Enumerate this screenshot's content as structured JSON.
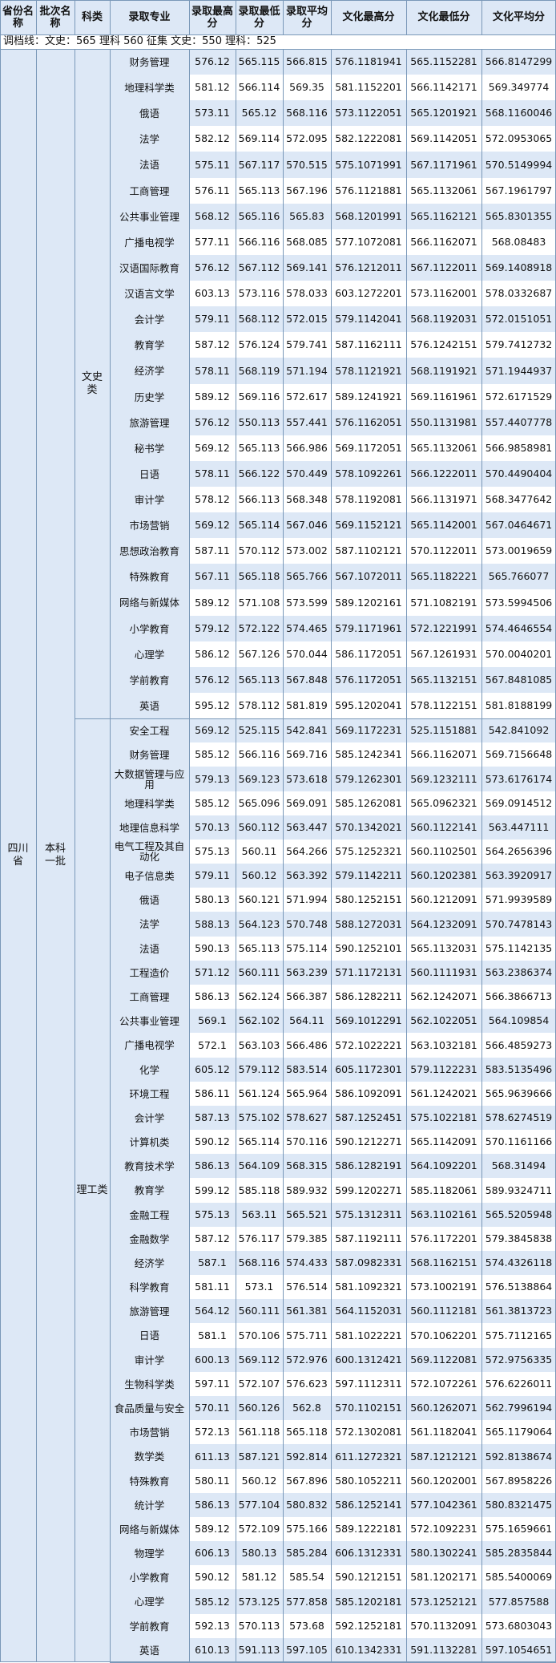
{
  "headers": [
    "省份名称",
    "批次名称",
    "科类",
    "录取专业",
    "录取最高分",
    "录取最低分",
    "录取平均分",
    "文化最高分",
    "文化最低分",
    "文化平均分"
  ],
  "note": "调档线：文史：565  理科 560 征集 文史：550 理科：525",
  "province": "四川省",
  "batch": "本科一批",
  "groups": [
    {
      "name": "文史类",
      "rows": [
        [
          "财务管理",
          "576.12",
          "565.115",
          "566.815",
          "576.1181941",
          "565.1152281",
          "566.8147299"
        ],
        [
          "地理科学类",
          "581.12",
          "566.114",
          "569.35",
          "581.1152201",
          "566.1142171",
          "569.349774"
        ],
        [
          "俄语",
          "573.11",
          "565.12",
          "568.116",
          "573.1122051",
          "565.1201921",
          "568.1160046"
        ],
        [
          "法学",
          "582.12",
          "569.114",
          "572.095",
          "582.1222081",
          "569.1142051",
          "572.0953065"
        ],
        [
          "法语",
          "575.11",
          "567.117",
          "570.515",
          "575.1071991",
          "567.1171961",
          "570.5149994"
        ],
        [
          "工商管理",
          "576.11",
          "565.113",
          "567.196",
          "576.1121881",
          "565.1132061",
          "567.1961797"
        ],
        [
          "公共事业管理",
          "568.12",
          "565.116",
          "565.83",
          "568.1201991",
          "565.1162121",
          "565.8301355"
        ],
        [
          "广播电视学",
          "577.11",
          "566.116",
          "568.085",
          "577.1072081",
          "566.1162071",
          "568.08483"
        ],
        [
          "汉语国际教育",
          "576.12",
          "567.112",
          "569.141",
          "576.1212011",
          "567.1122011",
          "569.1408918"
        ],
        [
          "汉语言文学",
          "603.13",
          "573.116",
          "578.033",
          "603.1272201",
          "573.1162001",
          "578.0332687"
        ],
        [
          "会计学",
          "579.11",
          "568.112",
          "572.015",
          "579.1142041",
          "568.1192031",
          "572.0151051"
        ],
        [
          "教育学",
          "587.12",
          "576.124",
          "579.741",
          "587.1162111",
          "576.1242151",
          "579.7412732"
        ],
        [
          "经济学",
          "578.11",
          "568.119",
          "571.194",
          "578.1121921",
          "568.1191921",
          "571.1944937"
        ],
        [
          "历史学",
          "589.12",
          "569.116",
          "572.617",
          "589.1241921",
          "569.1161961",
          "572.6171529"
        ],
        [
          "旅游管理",
          "576.12",
          "550.113",
          "557.441",
          "576.1162051",
          "550.1131981",
          "557.4407778"
        ],
        [
          "秘书学",
          "569.12",
          "565.113",
          "566.986",
          "569.1172051",
          "565.1132061",
          "566.9858981"
        ],
        [
          "日语",
          "578.11",
          "566.122",
          "570.449",
          "578.1092261",
          "566.1222011",
          "570.4490404"
        ],
        [
          "审计学",
          "578.12",
          "566.113",
          "568.348",
          "578.1192081",
          "566.1131971",
          "568.3477642"
        ],
        [
          "市场营销",
          "569.12",
          "565.114",
          "567.046",
          "569.1152121",
          "565.1142001",
          "567.0464671"
        ],
        [
          "思想政治教育",
          "587.11",
          "570.112",
          "573.002",
          "587.1102121",
          "570.1122011",
          "573.0019659"
        ],
        [
          "特殊教育",
          "567.11",
          "565.118",
          "565.766",
          "567.1072011",
          "565.1182221",
          "565.766077"
        ],
        [
          "网络与新媒体",
          "589.12",
          "571.108",
          "573.599",
          "589.1202161",
          "571.1082191",
          "573.5994506"
        ],
        [
          "小学教育",
          "579.12",
          "572.122",
          "574.465",
          "579.1171961",
          "572.1221991",
          "574.4646554"
        ],
        [
          "心理学",
          "586.12",
          "567.126",
          "570.044",
          "586.1172051",
          "567.1261931",
          "570.0040201"
        ],
        [
          "学前教育",
          "576.12",
          "565.113",
          "567.848",
          "576.1172051",
          "565.1132151",
          "567.8481085"
        ],
        [
          "英语",
          "595.12",
          "578.112",
          "581.819",
          "595.1202041",
          "578.1122151",
          "581.8188199"
        ]
      ]
    },
    {
      "name": "理工类",
      "rows": [
        [
          "安全工程",
          "569.12",
          "525.115",
          "542.841",
          "569.1172231",
          "525.1151881",
          "542.841092"
        ],
        [
          "财务管理",
          "585.12",
          "566.116",
          "569.716",
          "585.1242341",
          "566.1162071",
          "569.7156648"
        ],
        [
          "大数据管理与应用",
          "579.13",
          "569.123",
          "573.618",
          "579.1262301",
          "569.1232111",
          "573.6176174"
        ],
        [
          "地理科学类",
          "585.12",
          "565.096",
          "569.091",
          "585.1262081",
          "565.0962321",
          "569.0914512"
        ],
        [
          "地理信息科学",
          "570.13",
          "560.112",
          "563.447",
          "570.1342021",
          "560.1122141",
          "563.447111"
        ],
        [
          "电气工程及其自动化",
          "575.13",
          "560.11",
          "564.266",
          "575.1252321",
          "560.1102501",
          "564.2656396"
        ],
        [
          "电子信息类",
          "579.11",
          "560.12",
          "563.392",
          "579.1142211",
          "560.1202381",
          "563.3920917"
        ],
        [
          "俄语",
          "580.13",
          "560.121",
          "571.994",
          "580.1252151",
          "560.1212091",
          "571.9939589"
        ],
        [
          "法学",
          "588.13",
          "564.123",
          "570.748",
          "588.1272031",
          "564.1232091",
          "570.7478143"
        ],
        [
          "法语",
          "590.13",
          "565.113",
          "575.114",
          "590.1252101",
          "565.1132031",
          "575.1142135"
        ],
        [
          "工程造价",
          "571.12",
          "560.111",
          "563.239",
          "571.1172131",
          "560.1111931",
          "563.2386374"
        ],
        [
          "工商管理",
          "586.13",
          "562.124",
          "566.387",
          "586.1282211",
          "562.1242071",
          "566.3866713"
        ],
        [
          "公共事业管理",
          "569.1",
          "562.102",
          "564.11",
          "569.1012291",
          "562.1022051",
          "564.109854"
        ],
        [
          "广播电视学",
          "572.1",
          "563.103",
          "566.486",
          "572.1022221",
          "563.1032181",
          "566.4859273"
        ],
        [
          "化学",
          "605.12",
          "579.112",
          "583.514",
          "605.1172301",
          "579.1122231",
          "583.5135496"
        ],
        [
          "环境工程",
          "586.11",
          "561.124",
          "565.964",
          "586.1092091",
          "561.1242021",
          "565.9639666"
        ],
        [
          "会计学",
          "587.13",
          "575.102",
          "578.627",
          "587.1252451",
          "575.1022181",
          "578.6274519"
        ],
        [
          "计算机类",
          "590.12",
          "565.114",
          "570.116",
          "590.1212271",
          "565.1142091",
          "570.1161166"
        ],
        [
          "教育技术学",
          "586.13",
          "564.109",
          "568.315",
          "586.1282191",
          "564.1092201",
          "568.31494"
        ],
        [
          "教育学",
          "599.12",
          "585.118",
          "589.932",
          "599.1202271",
          "585.1182061",
          "589.9324711"
        ],
        [
          "金融工程",
          "575.13",
          "563.11",
          "565.521",
          "575.1312311",
          "563.1102161",
          "565.5205948"
        ],
        [
          "金融数学",
          "587.12",
          "576.117",
          "579.385",
          "587.1192111",
          "576.1172201",
          "579.3845838"
        ],
        [
          "经济学",
          "587.1",
          "568.116",
          "574.433",
          "587.0982331",
          "568.1162151",
          "574.4326118"
        ],
        [
          "科学教育",
          "581.11",
          "573.1",
          "576.514",
          "581.1092321",
          "573.1002191",
          "576.5138864"
        ],
        [
          "旅游管理",
          "564.12",
          "560.111",
          "561.381",
          "564.1152031",
          "560.1112181",
          "561.3813723"
        ],
        [
          "日语",
          "581.1",
          "570.106",
          "575.711",
          "581.1022221",
          "570.1062201",
          "575.7112165"
        ],
        [
          "审计学",
          "600.13",
          "569.112",
          "572.976",
          "600.1312421",
          "569.1122081",
          "572.9756335"
        ],
        [
          "生物科学类",
          "597.11",
          "572.107",
          "576.623",
          "597.1112311",
          "572.1072261",
          "576.6226011"
        ],
        [
          "食品质量与安全",
          "570.11",
          "560.126",
          "562.8",
          "570.1102151",
          "560.1262071",
          "562.7996194"
        ],
        [
          "市场营销",
          "572.13",
          "561.118",
          "565.118",
          "572.1302081",
          "561.1182041",
          "565.1179064"
        ],
        [
          "数学类",
          "611.13",
          "587.121",
          "592.814",
          "611.1272321",
          "587.1212121",
          "592.8138674"
        ],
        [
          "特殊教育",
          "580.11",
          "560.12",
          "567.896",
          "580.1052211",
          "560.1202001",
          "567.8958226"
        ],
        [
          "统计学",
          "586.13",
          "577.104",
          "580.832",
          "586.1252141",
          "577.1042361",
          "580.8321475"
        ],
        [
          "网络与新媒体",
          "589.12",
          "572.109",
          "575.166",
          "589.1222181",
          "572.1092231",
          "575.1659661"
        ],
        [
          "物理学",
          "606.13",
          "580.13",
          "585.284",
          "606.1312331",
          "580.1302241",
          "585.2835844"
        ],
        [
          "小学教育",
          "590.12",
          "581.12",
          "585.54",
          "590.1212151",
          "581.1202171",
          "585.5400069"
        ],
        [
          "心理学",
          "585.12",
          "573.125",
          "577.858",
          "585.1202181",
          "573.1252121",
          "577.857588"
        ],
        [
          "学前教育",
          "592.13",
          "570.113",
          "573.68",
          "592.1252181",
          "570.1132091",
          "573.6803043"
        ],
        [
          "英语",
          "610.13",
          "591.113",
          "597.105",
          "610.1342331",
          "591.1132281",
          "597.1054651"
        ]
      ]
    }
  ]
}
